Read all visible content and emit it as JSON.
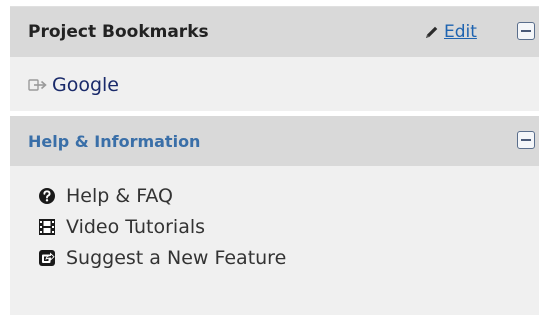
{
  "colors": {
    "header_background": "#d9d9d9",
    "panel_background": "#f0f0f0",
    "help_title": "#3a6fa8",
    "link": "#1e63b0"
  },
  "bookmarks_panel": {
    "title": "Project Bookmarks",
    "edit_label": "Edit",
    "edit_icon": "pencil-icon",
    "collapse_icon": "minus-square-icon",
    "items": [
      {
        "label": "Google",
        "icon": "external-link-arrow-icon"
      }
    ]
  },
  "help_panel": {
    "title": "Help & Information",
    "collapse_icon": "minus-square-icon",
    "items": [
      {
        "label": "Help & FAQ",
        "icon": "question-circle-icon"
      },
      {
        "label": "Video Tutorials",
        "icon": "film-icon"
      },
      {
        "label": "Suggest a New Feature",
        "icon": "share-square-icon"
      }
    ]
  }
}
